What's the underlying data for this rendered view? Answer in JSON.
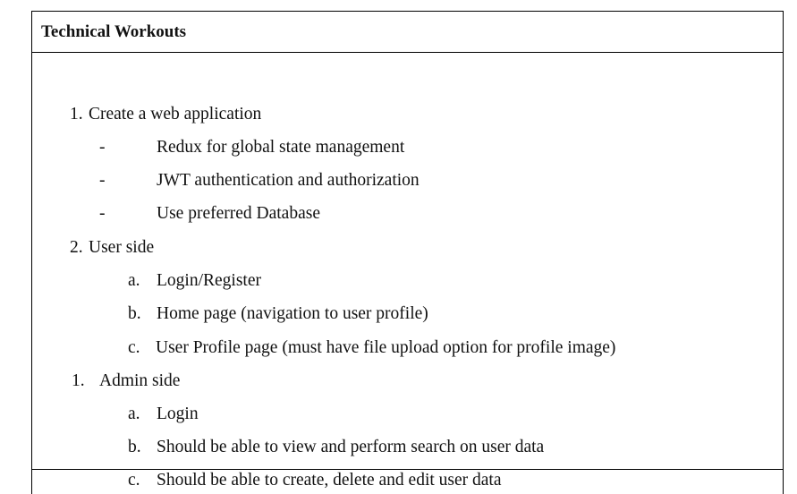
{
  "title": "Technical Workouts",
  "section1": {
    "number": "1.",
    "label": "Create a web application",
    "items": [
      {
        "marker": "-",
        "text": "Redux for global state management"
      },
      {
        "marker": "-",
        "text": "JWT authentication and authorization"
      },
      {
        "marker": "-",
        "text": "Use preferred Database"
      }
    ]
  },
  "section2": {
    "number": "2.",
    "label": "User side",
    "items": [
      {
        "marker": "a.",
        "text": "Login/Register"
      },
      {
        "marker": "b.",
        "text": "Home page (navigation to user profile)"
      },
      {
        "marker": "c.",
        "text": "User Profile page (must have file upload option for profile image)"
      }
    ]
  },
  "section3": {
    "number": "1.",
    "label": "Admin side",
    "items": [
      {
        "marker": "a.",
        "text": "Login"
      },
      {
        "marker": "b.",
        "text": "Should be able to view and perform search on user data"
      },
      {
        "marker": "c.",
        "text": "Should be able to create, delete and edit user data"
      }
    ]
  }
}
